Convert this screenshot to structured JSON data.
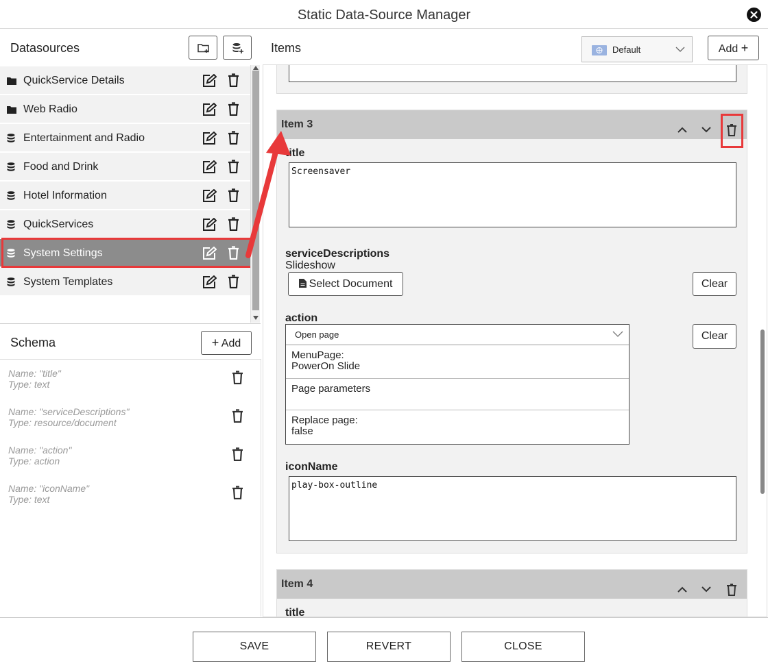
{
  "window": {
    "title": "Static Data-Source Manager"
  },
  "datasources": {
    "title": "Datasources",
    "items": [
      {
        "label": "QuickService Details",
        "icon": "folder-icon"
      },
      {
        "label": "Web Radio",
        "icon": "folder-icon"
      },
      {
        "label": "Entertainment and Radio",
        "icon": "database-icon"
      },
      {
        "label": "Food and Drink",
        "icon": "database-icon"
      },
      {
        "label": "Hotel Information",
        "icon": "database-icon"
      },
      {
        "label": "QuickServices",
        "icon": "database-icon"
      },
      {
        "label": "System Settings",
        "icon": "database-icon",
        "selected": true
      },
      {
        "label": "System Templates",
        "icon": "database-icon"
      }
    ]
  },
  "schema": {
    "title": "Schema",
    "add_label": "Add",
    "fields": [
      {
        "name": "Name: \"title\"",
        "type": "Type: text"
      },
      {
        "name": "Name: \"serviceDescriptions\"",
        "type": "Type: resource/document"
      },
      {
        "name": "Name: \"action\"",
        "type": "Type: action"
      },
      {
        "name": "Name: \"iconName\"",
        "type": "Type: text"
      }
    ]
  },
  "items": {
    "title": "Items",
    "language": "Default",
    "add_label": "Add",
    "item3": {
      "header": "Item 3",
      "title_label": "title",
      "title_value": "Screensaver",
      "sd_label": "serviceDescriptions",
      "sd_value": "Slideshow",
      "select_doc_label": "Select Document",
      "clear_label": "Clear",
      "action_label": "action",
      "action_value": "Open page",
      "action_rows": [
        {
          "line1": "MenuPage:",
          "line2": "PowerOn Slide"
        },
        {
          "line1": "Page parameters",
          "line2": ""
        },
        {
          "line1": "Replace page:",
          "line2": "false"
        }
      ],
      "icon_label": "iconName",
      "icon_value": "play-box-outline"
    },
    "item4": {
      "header": "Item 4",
      "title_label": "title"
    }
  },
  "footer": {
    "save": "SAVE",
    "revert": "REVERT",
    "close": "CLOSE"
  },
  "colors": {
    "accent_red": "#e8393a",
    "selected_row": "#8c8c8c",
    "item_header": "#c9c9c9"
  }
}
